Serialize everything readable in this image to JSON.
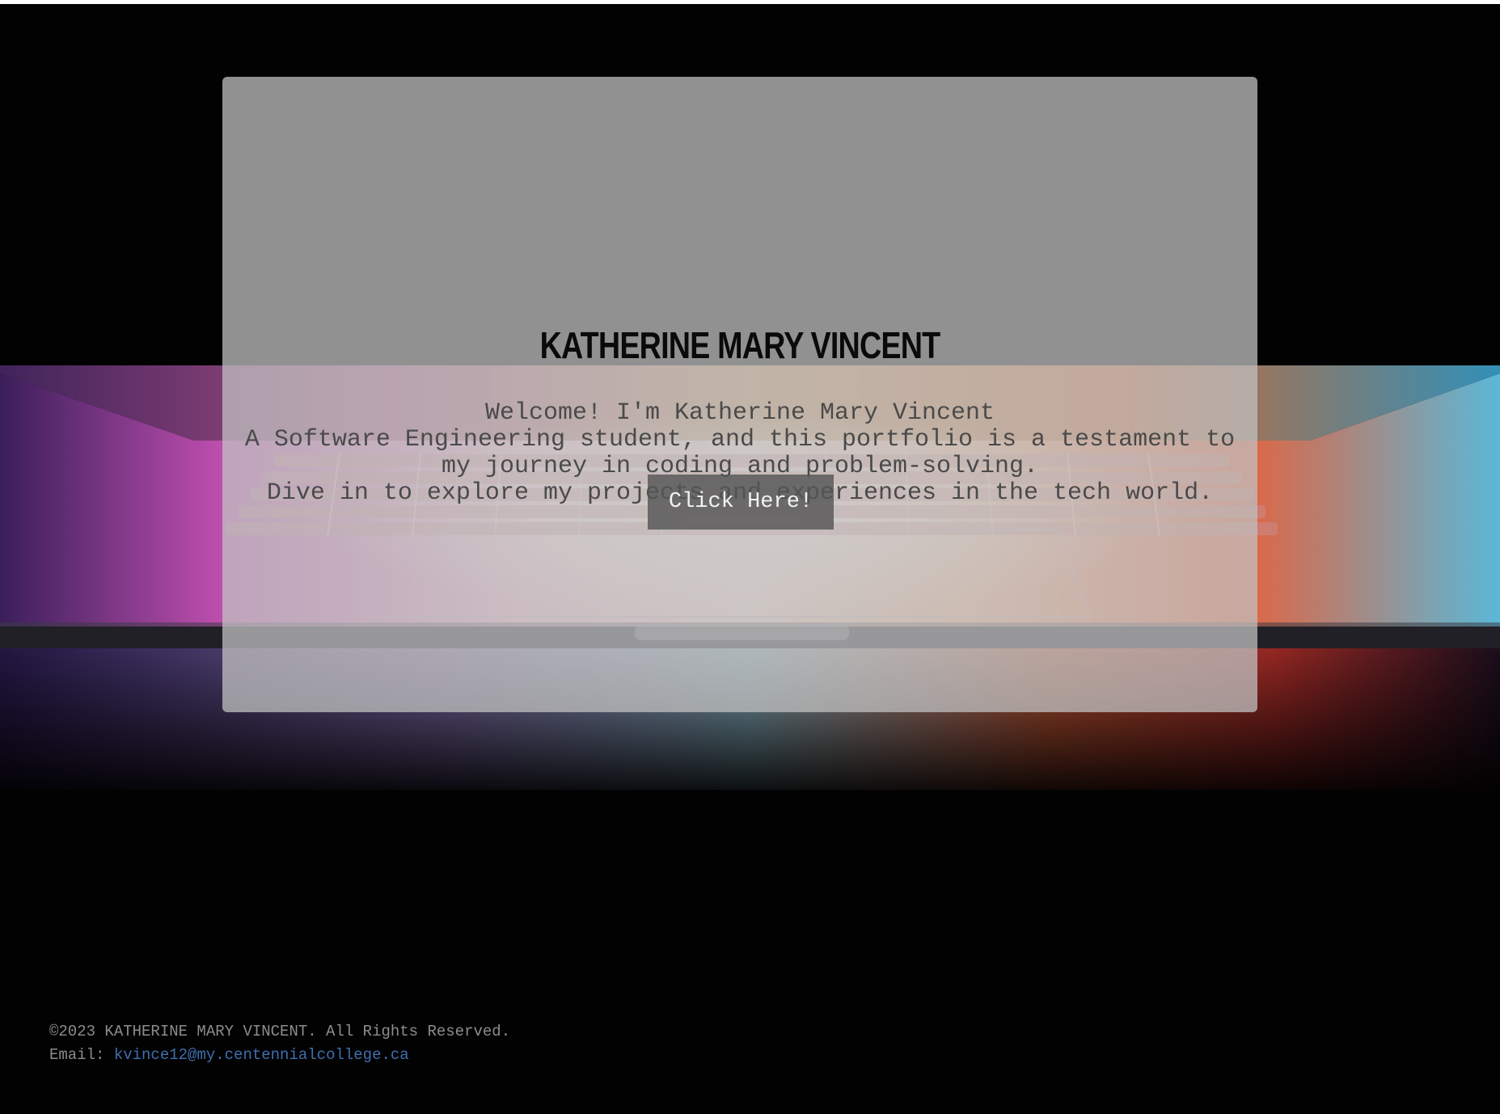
{
  "hero": {
    "title": "KATHERINE MARY VINCENT",
    "intro_lines": [
      "Welcome! I'm Katherine Mary Vincent",
      "A Software Engineering student, and this portfolio is a testament to my journey in coding and problem-solving.",
      "Dive in to explore my projects and experiences in the tech world."
    ],
    "button_label": "Click Here!"
  },
  "background": {
    "subject": "laptop-with-glowing-keyboard",
    "colors": {
      "base": "#020203",
      "glow_orange": "#e8603a",
      "glow_pink": "#d85ab8",
      "glow_blue": "#6fc4e6",
      "glow_red": "#c23a2a"
    }
  },
  "panel": {
    "color": "#bebebe"
  },
  "footer": {
    "copyright": "©2023 KATHERINE MARY VINCENT. All Rights Reserved.",
    "email_label": "Email: ",
    "email": "kvince12@my.centennialcollege.ca",
    "link_color": "#3f6fae"
  }
}
